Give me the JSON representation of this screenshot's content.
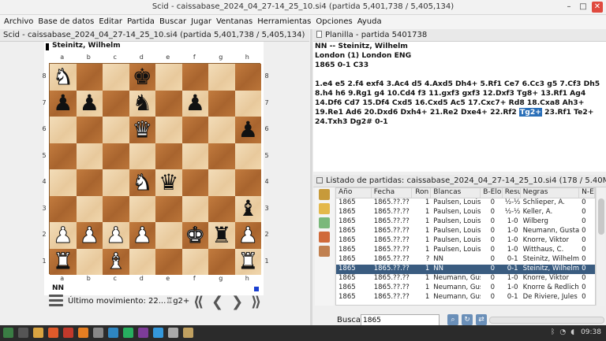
{
  "window": {
    "title": "Scid - caissabase_2024_04_27-14_25_10.si4 (partida 5,401,738 / 5,405,134)"
  },
  "menu": [
    "Archivo",
    "Base de datos",
    "Editar",
    "Partida",
    "Buscar",
    "Jugar",
    "Ventanas",
    "Herramientas",
    "Opciones",
    "Ayuda"
  ],
  "board_pane": {
    "header": "Scid - caissabase_2024_04_27-14_25_10.si4 (partida 5,401,738 / 5,405,134)",
    "top_player": "Steinitz, Wilhelm",
    "bottom_player": "NN",
    "files": [
      "a",
      "b",
      "c",
      "d",
      "e",
      "f",
      "g",
      "h"
    ],
    "ranks": [
      "8",
      "7",
      "6",
      "5",
      "4",
      "3",
      "2",
      "1"
    ],
    "position": [
      [
        "wN",
        "",
        "",
        "bK",
        "",
        "",
        "",
        ""
      ],
      [
        "bP",
        "bP",
        "",
        "bN",
        "",
        "bP",
        "",
        ""
      ],
      [
        "",
        "",
        "",
        "wQ",
        "",
        "",
        "",
        "bP"
      ],
      [
        "",
        "",
        "",
        "",
        "",
        "",
        "",
        ""
      ],
      [
        "",
        "",
        "",
        "wN",
        "bQ",
        "",
        "",
        ""
      ],
      [
        "",
        "",
        "",
        "",
        "",
        "",
        "",
        "bB"
      ],
      [
        "wP",
        "wP",
        "wP",
        "wP",
        "",
        "wK",
        "bR",
        "wP"
      ],
      [
        "wR",
        "",
        "wB",
        "",
        "",
        "",
        "",
        "wR"
      ]
    ],
    "status_label": "Último movimiento: 22...♖g2+"
  },
  "nav_buttons": [
    "⟪",
    "❮",
    "❯",
    "⟫"
  ],
  "pgn_pane": {
    "header": "Planilla - partida 5401738",
    "line1": "NN  --  Steinitz, Wilhelm",
    "line2": "London (1)  London ENG",
    "line3": "1865  0-1  C33",
    "moves_before": "1.e4 e5 2.f4 exf4 3.Ac4 d5 4.Axd5 Dh4+ 5.Rf1 Ce7 6.Cc3 g5 7.Cf3 Dh5 8.h4 h6 9.Rg1 g4 10.Cd4 f3 11.gxf3 gxf3 12.Dxf3 Tg8+ 13.Rf1 Ag4 14.Df6 Cd7 15.Df4 Cxd5 16.Cxd5 Ac5 17.Cxc7+ Rd8 18.Cxa8 Ah3+ 19.Re1 Ad6 20.Dxd6 Dxh4+ 21.Re2 Dxe4+ 22.Rf2",
    "moves_highlight": "Tg2+",
    "moves_after": "23.Rf1 Te2+ 24.Txh3 Dg2# 0-1"
  },
  "games_list": {
    "header": "Listado de partidas: caissabase_2024_04_27-14_25_10.si4 (178 / 5.40M)",
    "columns": [
      "Año",
      "Fecha",
      "Ron",
      "Blancas",
      "B-Elo",
      "Resu",
      "Negras",
      "N-E"
    ],
    "rows": [
      [
        "1865",
        "1865.??.??",
        "1",
        "Paulsen, Louis",
        "0",
        "½-½",
        "Schlieper, A.",
        "0"
      ],
      [
        "1865",
        "1865.??.??",
        "1",
        "Paulsen, Louis",
        "0",
        "½-½",
        "Keller, A.",
        "0"
      ],
      [
        "1865",
        "1865.??.??",
        "1",
        "Paulsen, Louis",
        "0",
        "1-0",
        "Wilberg",
        "0"
      ],
      [
        "1865",
        "1865.??.??",
        "1",
        "Paulsen, Louis",
        "0",
        "1-0",
        "Neumann, Gustav",
        "0"
      ],
      [
        "1865",
        "1865.??.??",
        "1",
        "Paulsen, Louis",
        "0",
        "1-0",
        "Knorre, Viktor",
        "0"
      ],
      [
        "1865",
        "1865.??.??",
        "1",
        "Paulsen, Louis",
        "0",
        "1-0",
        "Witthaus, C.",
        "0"
      ],
      [
        "1865",
        "1865.??.??",
        "?",
        "NN",
        "0",
        "0-1",
        "Steinitz, Wilhelm",
        "0"
      ],
      [
        "1865",
        "1865.??.??",
        "1",
        "NN",
        "0",
        "0-1",
        "Steinitz, Wilhelm",
        "0"
      ],
      [
        "1865",
        "1865.??.??",
        "1",
        "Neumann, Gustav",
        "0",
        "1-0",
        "Knorre, Viktor",
        "0"
      ],
      [
        "1865",
        "1865.??.??",
        "1",
        "Neumann, Gustav",
        "0",
        "1-0",
        "Knorre & Redlich",
        "0"
      ],
      [
        "1865",
        "1865.??.??",
        "1",
        "Neumann, Gustav",
        "0",
        "0-1",
        "De Riviere, Jules",
        "0"
      ]
    ],
    "selected_index": 7,
    "toolbar_icons": [
      "book-icon",
      "search-icon",
      "table-icon",
      "chart-icon",
      "board-icon"
    ]
  },
  "search": {
    "label": "Buscar",
    "value": "1865"
  },
  "taskbar": {
    "clock": "09:38"
  },
  "colors": {
    "light_square": "#f0d9b5",
    "dark_square": "#b5713a",
    "selection": "#3a5c80",
    "move_highlight": "#2a6fb8"
  }
}
